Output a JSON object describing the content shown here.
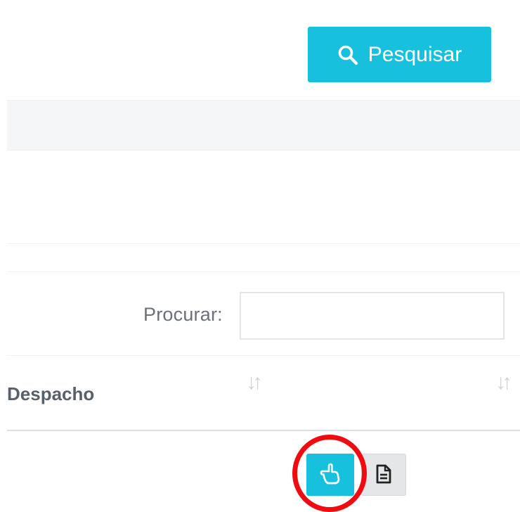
{
  "toolbar": {
    "search_button_label": "Pesquisar",
    "search_icon": "search-icon"
  },
  "filter": {
    "search_label": "Procurar:",
    "search_value": "",
    "search_placeholder": ""
  },
  "table": {
    "columns": [
      {
        "label": "Despacho",
        "sortable": true,
        "sort_icon": "sort-icon"
      },
      {
        "label": "",
        "sortable": true,
        "sort_icon": "sort-icon"
      }
    ],
    "rows": [
      {
        "actions": [
          {
            "icon": "hand-pointer-icon",
            "style": "primary",
            "highlighted": true
          },
          {
            "icon": "document-icon",
            "style": "default"
          }
        ]
      }
    ]
  },
  "colors": {
    "accent": "#17c1dd",
    "highlight": "#ef0b10",
    "band": "#f5f6f7",
    "secondary_button": "#e4e6e7"
  }
}
